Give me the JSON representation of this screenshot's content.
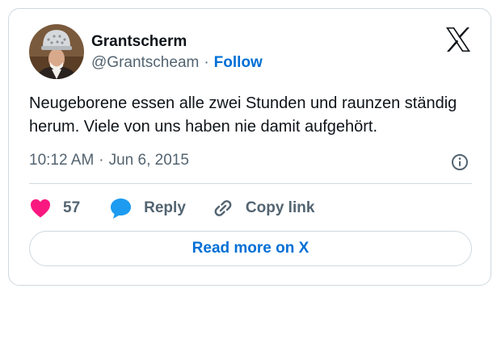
{
  "tweet": {
    "author_name": "Grantscherm",
    "handle": "@Grantscheam",
    "separator": "·",
    "follow_label": "Follow",
    "text": "Neugeborene essen alle zwei Stunden und raunzen ständig herum. Viele von uns haben nie damit aufgehört.",
    "time": "10:12 AM",
    "date": "Jun 6, 2015",
    "like_count": "57",
    "reply_label": "Reply",
    "copy_link_label": "Copy link",
    "read_more_label": "Read more on X"
  },
  "icons": {
    "brand": "x-logo-icon",
    "info": "info-icon",
    "like": "heart-icon",
    "reply": "speech-bubble-icon",
    "copy": "link-icon"
  },
  "colors": {
    "text": "#0f1419",
    "secondary": "#536471",
    "link": "#006fd6",
    "heart": "#f91880",
    "reply_bubble": "#1d9bf0",
    "border": "#cfd9de"
  }
}
